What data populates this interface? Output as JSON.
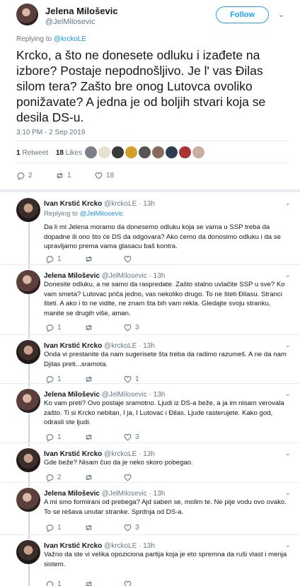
{
  "main": {
    "author_name": "Jelena Miloševic",
    "author_handle": "@JelMilosevic",
    "follow_label": "Follow",
    "replying_prefix": "Replying to",
    "replying_to": "@krckoLE",
    "text": "Krcko, a što ne donesete odluku i izađete na izbore? Postaje nepodnošljivo. Je l' vas Đilas silom tera? Zašto bre onog Lutovca ovoliko ponižavate? A jedna je od boljih stvari koja se desila DS-u.",
    "timestamp": "3:10 PM - 2 Sep 2019",
    "retweets_count": "1",
    "retweets_label": "Retweet",
    "likes_count": "18",
    "likes_label": "Likes",
    "likers": [
      "#7a7f88",
      "#e8e0d0",
      "#3a3a3a",
      "#d4a02a",
      "#555",
      "#8a6a5a",
      "#2c3e50",
      "#a33",
      "#c8b0a0"
    ],
    "reply_count": "2",
    "retweet_count": "1",
    "like_count": "18"
  },
  "replies": [
    {
      "name": "Ivan Krstić Krcko",
      "handle": "@krckoLE",
      "time": "· 13h",
      "replying_prefix": "Replying to",
      "replying_to": "@JelMilosevic",
      "text": "Da li mi Jelena moramo da donesemo odluku koja se vama u SSP treba da dopadne ili ono što će DS da odgovara? Ako ćemo da donosimo odluku i da se upravljamo prema vama glasacu baš kontra.",
      "reply": "1",
      "retweet": "",
      "like": ""
    },
    {
      "name": "Jelena Miloševic",
      "handle": "@JelMilosevic",
      "time": "· 13h",
      "text": "Donesite odluku, a ne samo da raspredate. Zašto stalno uvlačite SSP u sve? Ko vam smeta? Lutovac priča jedno, vas nekoliko drugo. To ne šteti Đilasu. Stranci šteti. A ako i to ne vidite, ne znam šta bih vam rekla. Gledajte svoju stranku, manite se drugih više, aman.",
      "reply": "1",
      "retweet": "",
      "like": "3"
    },
    {
      "name": "Ivan Krstić Krcko",
      "handle": "@krckoLE",
      "time": "· 13h",
      "text": "Onda vi prestanite da nam sugerisete šta treba da radimo razumeš. A ne da nam Djilas preti...sramota.",
      "reply": "1",
      "retweet": "",
      "like": "1"
    },
    {
      "name": "Jelena Miloševic",
      "handle": "@JelMilosevic",
      "time": "· 13h",
      "text": "Ko vam preti? Ovo postaje sramotno. Ljudi iz DS-a beže, a ja im nisam verovala zašto. Ti si Krcko nebitan, I ja, I Lutovac i Đilas. Ljude rasterujete. Kako god, odrasli ste ljudi.",
      "reply": "1",
      "retweet": "",
      "like": "3"
    },
    {
      "name": "Ivan Krstić Krcko",
      "handle": "@krckoLE",
      "time": "· 13h",
      "text": "Gde beže? Nisam čuo da je neko skoro pobegao.",
      "reply": "2",
      "retweet": "",
      "like": ""
    },
    {
      "name": "Jelena Miloševic",
      "handle": "@JelMilosevic",
      "time": "· 13h",
      "text": "A mi smo formirani od prebega? Ajd saberi se, molim te. Ne pije vodu ovo ovako. To se rešava unutar stranke. Sprdnja od DS-a.",
      "reply": "1",
      "retweet": "",
      "like": "3"
    },
    {
      "name": "Ivan Krstić Krcko",
      "handle": "@krckoLE",
      "time": "· 13h",
      "text": "Važno da ste vi velika opoziciona partija koja je eto spremna da ruši vlast i menja sistem.",
      "reply": "1",
      "retweet": "",
      "like": ""
    }
  ]
}
